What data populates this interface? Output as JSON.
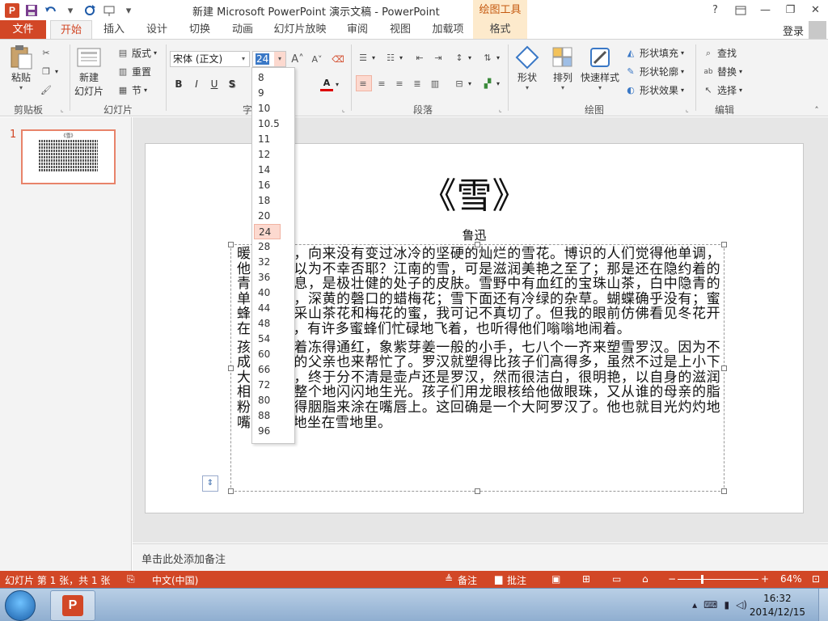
{
  "window": {
    "title": "新建 Microsoft PowerPoint 演示文稿 - PowerPoint",
    "context_tab_header": "绘图工具",
    "help": "?",
    "ribbon_display_icon": "ribbon-display-icon",
    "minimize": "—",
    "restore": "❐",
    "close": "✕"
  },
  "qat": {
    "app_icon": "P",
    "save_icon": "save-icon",
    "undo_icon": "undo-icon",
    "redo_icon": "repeat-icon",
    "start_from_beginning_icon": "start-from-beginning-icon",
    "customize_icon": "customize-qat-icon"
  },
  "tabs": {
    "file": "文件",
    "items": [
      "开始",
      "插入",
      "设计",
      "切换",
      "动画",
      "幻灯片放映",
      "审阅",
      "视图",
      "加载项",
      "格式"
    ],
    "active": "开始",
    "sign_in": "登录"
  },
  "ribbon": {
    "clipboard": {
      "paste": "粘贴",
      "label": "剪贴板"
    },
    "slides": {
      "new_slide": "新建",
      "new_slide_2": "幻灯片",
      "layout": "版式",
      "reset": "重置",
      "section": "节",
      "label": "幻灯片"
    },
    "font": {
      "name": "宋体 (正文)",
      "size": "24",
      "bold": "B",
      "italic": "I",
      "underline": "U",
      "shadow": "S",
      "label": "字"
    },
    "paragraph": {
      "label": "段落"
    },
    "drawing": {
      "shapes": "形状",
      "arrange": "排列",
      "quick_styles": "快速样式",
      "shape_fill": "形状填充",
      "shape_outline": "形状轮廓",
      "shape_effects": "形状效果",
      "label": "绘图"
    },
    "editing": {
      "find": "查找",
      "replace": "替换",
      "select": "选择",
      "label": "编辑"
    }
  },
  "font_size_options": [
    "8",
    "9",
    "10",
    "10.5",
    "11",
    "12",
    "14",
    "16",
    "18",
    "20",
    "24",
    "28",
    "32",
    "36",
    "40",
    "44",
    "48",
    "54",
    "60",
    "66",
    "72",
    "80",
    "88",
    "96"
  ],
  "font_size_selected": "24",
  "thumbnails": {
    "slide_number": "1",
    "mini_title": "《雪》"
  },
  "slide": {
    "title": "《雪》",
    "author": "鲁迅",
    "paragraph1": "暖国的雨，向来没有变过冰冷的坚硬的灿烂的雪花。博识的人们觉得他单调，他自己也以为不幸否耶？江南的雪，可是滋润美艳之至了；那是还在隐约着的青春的消息，是极壮健的处子的皮肤。雪野中有血红的宝珠山茶，白中隐青的单瓣梅花，深黄的磬口的蜡梅花；雪下面还有冷绿的杂草。蝴蝶确乎没有；蜜蜂是否来采山茶花和梅花的蜜，我可记不真切了。但我的眼前仿佛看见冬花开在雪野中，有许多蜜蜂们忙碌地飞着，也听得他们嗡嗡地闹着。",
    "paragraph2": "孩子们呵着冻得通红，象紫芽姜一般的小手，七八个一齐来塑雪罗汉。因为不成功，谁的父亲也来帮忙了。罗汉就塑得比孩子们高得多，虽然不过是上小下大的一堆，终于分不清是壶卢还是罗汉，然而很洁白，很明艳，以自身的滋润相粘结，整个地闪闪地生光。孩子们用龙眼核给他做眼珠，又从谁的母亲的脂粉奁中偷得胭脂来涂在嘴唇上。这回确是一个大阿罗汉了。他也就目光灼灼地嘴唇通红地坐在雪地里。"
  },
  "notes": {
    "placeholder": "单击此处添加备注"
  },
  "status": {
    "slide_info": "幻灯片 第 1 张，共 1 张",
    "language": "中文(中国)",
    "notes": "备注",
    "comments": "批注",
    "zoom_out": "−",
    "zoom_in": "+",
    "zoom": "64%",
    "zoom_fraction": 0.64
  },
  "taskbar": {
    "time": "16:32",
    "date": "2014/12/15"
  },
  "colors": {
    "accent": "#d24726",
    "context": "#fdeacc"
  }
}
